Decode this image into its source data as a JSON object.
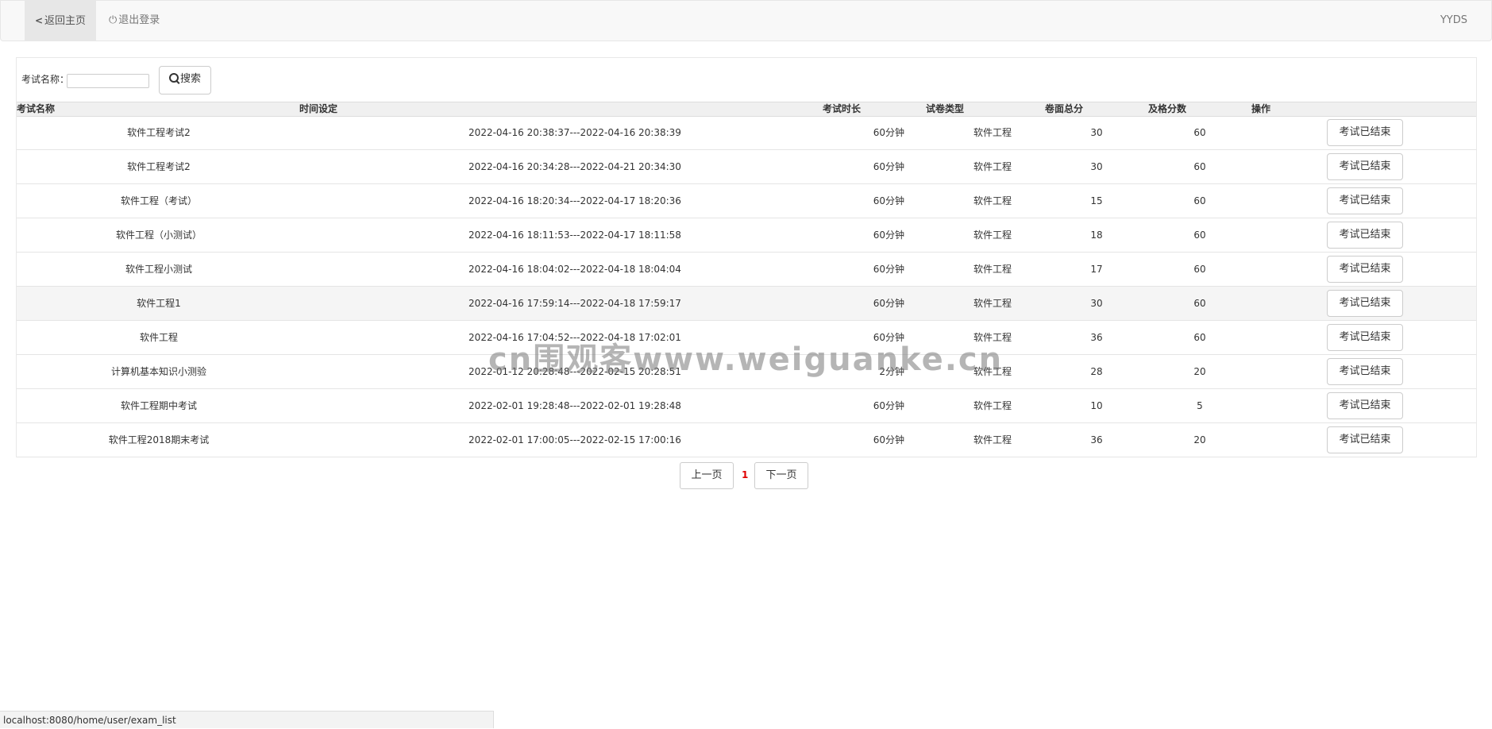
{
  "nav": {
    "back_label": "返回主页",
    "logout_label": "退出登录",
    "user_label": "YYDS"
  },
  "search": {
    "label": "考试名称：",
    "value": "",
    "placeholder": "",
    "button_label": "搜索"
  },
  "table": {
    "headers": [
      "考试名称",
      "时间设定",
      "考试时长",
      "试卷类型",
      "卷面总分",
      "及格分数",
      "操作"
    ],
    "rows": [
      {
        "name": "软件工程考试2",
        "time": "2022-04-16 20:38:37---2022-04-16 20:38:39",
        "duration": "60分钟",
        "type": "软件工程",
        "total": "30",
        "pass": "60",
        "action": "考试已结束"
      },
      {
        "name": "软件工程考试2",
        "time": "2022-04-16 20:34:28---2022-04-21 20:34:30",
        "duration": "60分钟",
        "type": "软件工程",
        "total": "30",
        "pass": "60",
        "action": "考试已结束"
      },
      {
        "name": "软件工程（考试）",
        "time": "2022-04-16 18:20:34---2022-04-17 18:20:36",
        "duration": "60分钟",
        "type": "软件工程",
        "total": "15",
        "pass": "60",
        "action": "考试已结束"
      },
      {
        "name": "软件工程（小测试）",
        "time": "2022-04-16 18:11:53---2022-04-17 18:11:58",
        "duration": "60分钟",
        "type": "软件工程",
        "total": "18",
        "pass": "60",
        "action": "考试已结束"
      },
      {
        "name": "软件工程小测试",
        "time": "2022-04-16 18:04:02---2022-04-18 18:04:04",
        "duration": "60分钟",
        "type": "软件工程",
        "total": "17",
        "pass": "60",
        "action": "考试已结束"
      },
      {
        "name": "软件工程1",
        "time": "2022-04-16 17:59:14---2022-04-18 17:59:17",
        "duration": "60分钟",
        "type": "软件工程",
        "total": "30",
        "pass": "60",
        "action": "考试已结束"
      },
      {
        "name": "软件工程",
        "time": "2022-04-16 17:04:52---2022-04-18 17:02:01",
        "duration": "60分钟",
        "type": "软件工程",
        "total": "36",
        "pass": "60",
        "action": "考试已结束"
      },
      {
        "name": "计算机基本知识小测验",
        "time": "2022-01-12 20:28:48---2022-02-15 20:28:51",
        "duration": "2分钟",
        "type": "软件工程",
        "total": "28",
        "pass": "20",
        "action": "考试已结束"
      },
      {
        "name": "软件工程期中考试",
        "time": "2022-02-01 19:28:48---2022-02-01 19:28:48",
        "duration": "60分钟",
        "type": "软件工程",
        "total": "10",
        "pass": "5",
        "action": "考试已结束"
      },
      {
        "name": "软件工程2018期末考试",
        "time": "2022-02-01 17:00:05---2022-02-15 17:00:16",
        "duration": "60分钟",
        "type": "软件工程",
        "total": "36",
        "pass": "20",
        "action": "考试已结束"
      }
    ],
    "highlight_row": 5
  },
  "pagination": {
    "prev_label": "上一页",
    "current_page": "1",
    "next_label": "下一页"
  },
  "watermark": "cn围观客www.weiguanke.cn",
  "status_url": "localhost:8080/home/user/exam_list",
  "colors": {
    "navbar_bg": "#f8f8f8",
    "active_nav_bg": "#e7e7e7",
    "current_page": "#e00000",
    "highlight_row_bg": "#f5f5f5"
  }
}
